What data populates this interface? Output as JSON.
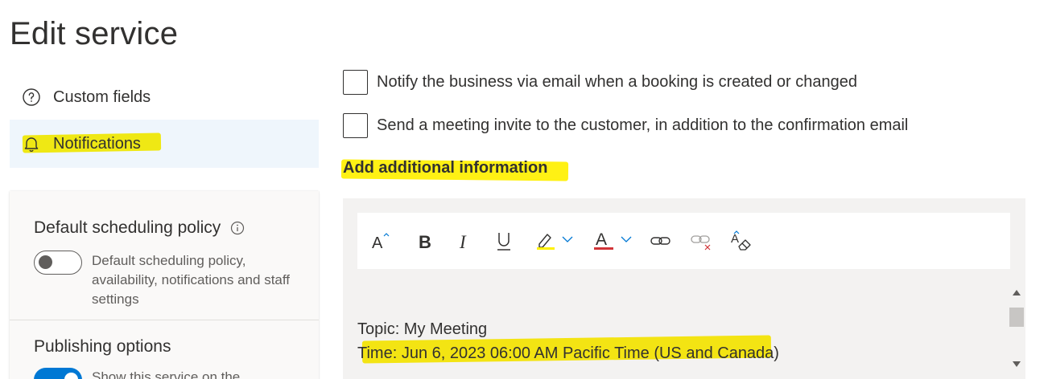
{
  "page": {
    "title": "Edit service"
  },
  "nav": {
    "custom_fields": "Custom fields",
    "notifications": "Notifications"
  },
  "policy": {
    "title": "Default scheduling policy",
    "toggle_state": "off",
    "description": "Default scheduling policy, availability, notifications and staff settings",
    "publishing_title": "Publishing options",
    "publishing_toggle_state": "on",
    "publishing_desc": "Show this service on the"
  },
  "notifications": {
    "checkbox_business": "Notify the business via email when a booking is created or changed",
    "checkbox_business_checked": false,
    "checkbox_invite": "Send a meeting invite to the customer, in addition to the confirmation email",
    "checkbox_invite_checked": false,
    "additional_info_heading": "Add additional information"
  },
  "editor": {
    "toolbar": [
      "font-size-icon",
      "bold-icon",
      "italic-icon",
      "underline-icon",
      "highlight-icon",
      "font-color-icon",
      "link-icon",
      "unlink-icon",
      "clear-format-icon"
    ],
    "line_topic": "Topic: My Meeting",
    "line_time": "Time: Jun 6, 2023 06:00 AM Pacific Time (US and Canada)"
  },
  "colors": {
    "accent": "#0078d4",
    "highlight": "#fff000",
    "font_color_bar": "#d13438",
    "highlight_bar": "#fff100",
    "nav_selected_bg": "#eff6fc"
  }
}
